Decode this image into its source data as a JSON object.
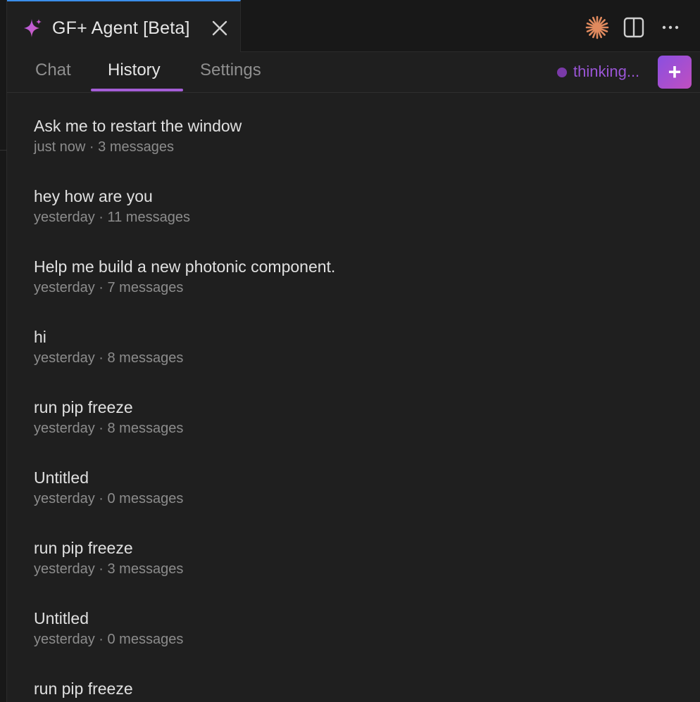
{
  "tab": {
    "title": "GF+ Agent [Beta]"
  },
  "nav": {
    "tabs": [
      "Chat",
      "History",
      "Settings"
    ],
    "active": "History",
    "status": "thinking...",
    "new_button": "+"
  },
  "colors": {
    "accent": "#a45ed6",
    "status": "#9a55d6",
    "tab_border": "#3b8eea"
  },
  "icons": [
    "sparkle-icon",
    "close-icon",
    "asterisk-icon",
    "split-editor-icon",
    "more-icon"
  ],
  "history": [
    {
      "title": "Ask me to restart the window",
      "meta": "just now · 3 messages"
    },
    {
      "title": "hey how are you",
      "meta": "yesterday · 11 messages"
    },
    {
      "title": "Help me build a new photonic component.",
      "meta": "yesterday · 7 messages"
    },
    {
      "title": "hi",
      "meta": "yesterday · 8 messages"
    },
    {
      "title": "run pip freeze",
      "meta": "yesterday · 8 messages"
    },
    {
      "title": "Untitled",
      "meta": "yesterday · 0 messages"
    },
    {
      "title": "run pip freeze",
      "meta": "yesterday · 3 messages"
    },
    {
      "title": "Untitled",
      "meta": "yesterday · 0 messages"
    },
    {
      "title": "run pip freeze",
      "meta": ""
    }
  ]
}
